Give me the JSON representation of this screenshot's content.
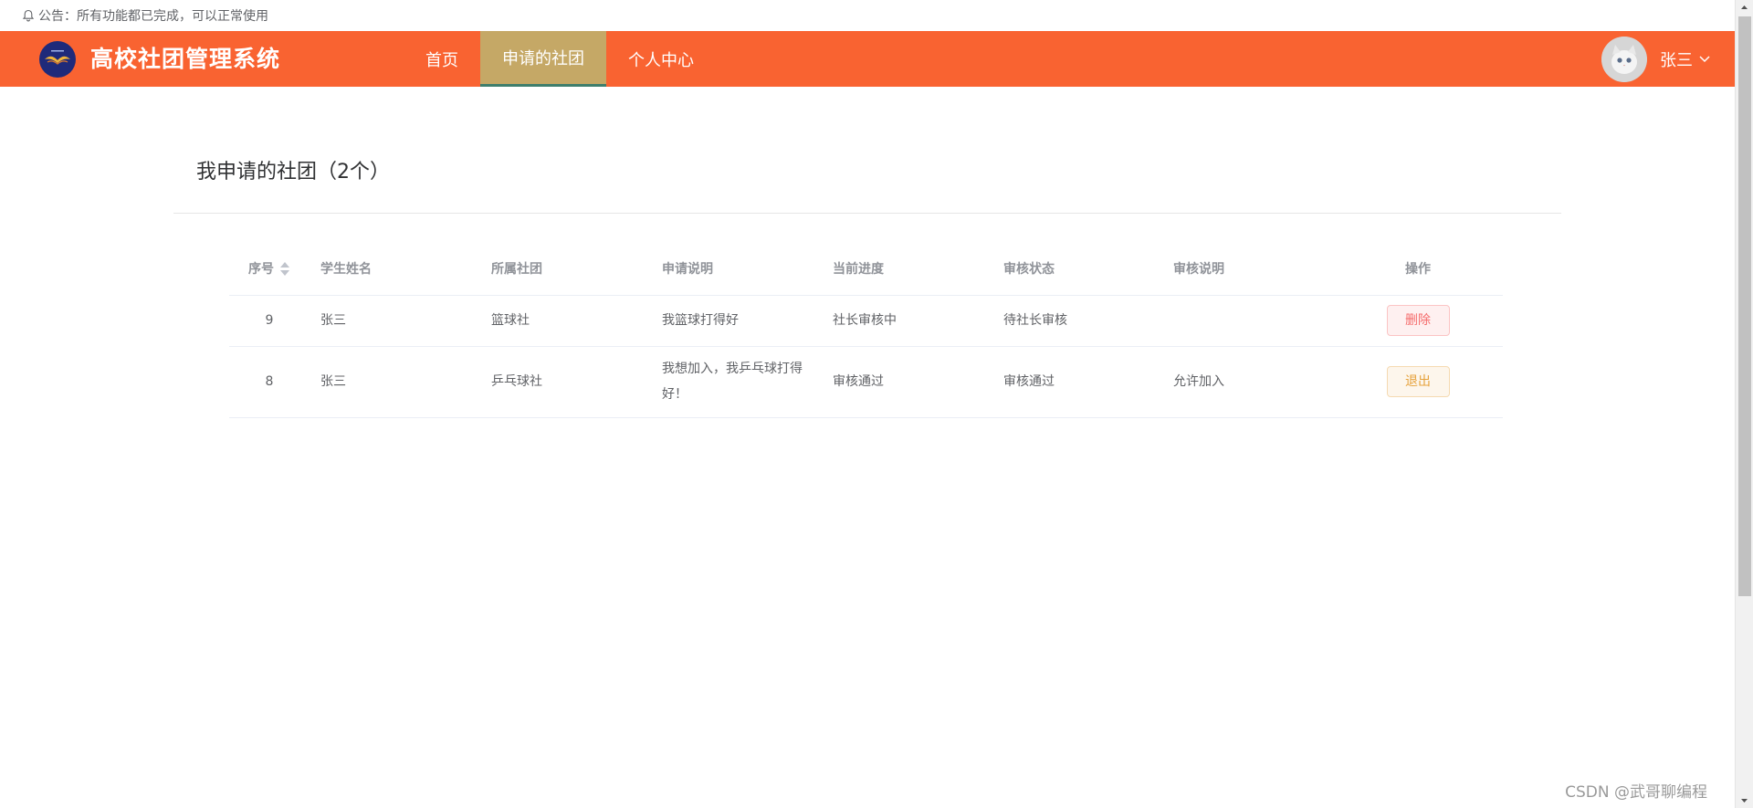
{
  "notice": {
    "text": "公告：所有功能都已完成，可以正常使用"
  },
  "header": {
    "title": "高校社团管理系统",
    "nav": [
      {
        "label": "首页",
        "active": false
      },
      {
        "label": "申请的社团",
        "active": true
      },
      {
        "label": "个人中心",
        "active": false
      }
    ],
    "user_name": "张三",
    "colors": {
      "bar": "#f96331",
      "active_tab": "#c5a866"
    }
  },
  "section": {
    "title": "我申请的社团（2个）"
  },
  "table": {
    "columns": [
      "序号",
      "学生姓名",
      "所属社团",
      "申请说明",
      "当前进度",
      "审核状态",
      "审核说明",
      "操作"
    ],
    "rows": [
      {
        "id": "9",
        "student": "张三",
        "club": "篮球社",
        "reason": "我篮球打得好",
        "progress": "社长审核中",
        "status": "待社长审核",
        "note": "",
        "action": "删除"
      },
      {
        "id": "8",
        "student": "张三",
        "club": "乒乓球社",
        "reason": "我想加入，我乒乓球打得好！",
        "progress": "审核通过",
        "status": "审核通过",
        "note": "允许加入",
        "action": "退出"
      }
    ]
  },
  "watermark": "CSDN @武哥聊编程"
}
